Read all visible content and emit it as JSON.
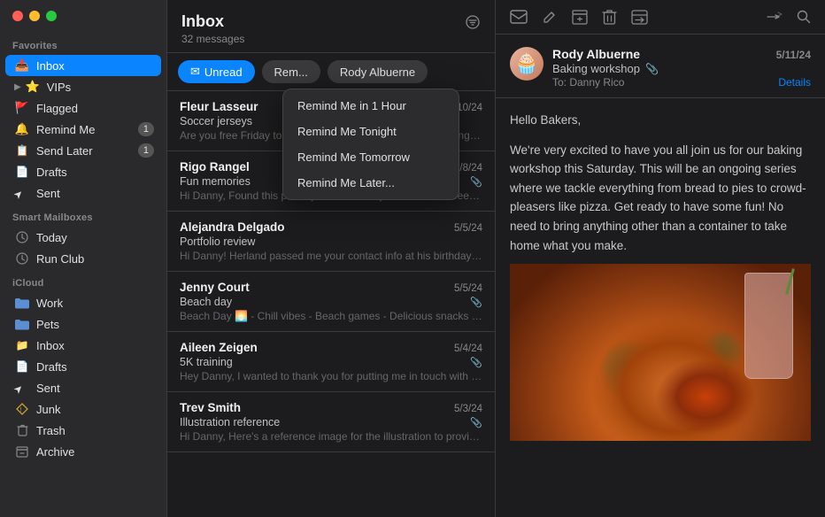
{
  "app": {
    "title": "Mail"
  },
  "sidebar": {
    "favorites_label": "Favorites",
    "smart_mailboxes_label": "Smart Mailboxes",
    "icloud_label": "iCloud",
    "items": {
      "inbox": {
        "label": "Inbox",
        "icon": "📥",
        "active": true
      },
      "vips": {
        "label": "VIPs",
        "icon": "⭐",
        "has_chevron": true
      },
      "flagged": {
        "label": "Flagged",
        "icon": "🚩"
      },
      "remind_me": {
        "label": "Remind Me",
        "icon": "🔔",
        "badge": "1"
      },
      "send_later": {
        "label": "Send Later",
        "icon": "📋",
        "badge": "1"
      },
      "drafts": {
        "label": "Drafts",
        "icon": "📄"
      },
      "sent": {
        "label": "Sent",
        "icon": "➤"
      },
      "today": {
        "label": "Today",
        "icon": "⚙"
      },
      "run_club": {
        "label": "Run Club",
        "icon": "⚙"
      },
      "work": {
        "label": "Work",
        "icon": "📁"
      },
      "pets": {
        "label": "Pets",
        "icon": "📁"
      },
      "icloud_inbox": {
        "label": "Inbox",
        "icon": "📁"
      },
      "icloud_drafts": {
        "label": "Drafts",
        "icon": "📄"
      },
      "icloud_sent": {
        "label": "Sent",
        "icon": "➤"
      },
      "junk": {
        "label": "Junk",
        "icon": "⚠"
      },
      "trash": {
        "label": "Trash",
        "icon": "🗑"
      },
      "archive": {
        "label": "Archive",
        "icon": "📦"
      }
    }
  },
  "message_list": {
    "title": "Inbox",
    "count": "32 messages",
    "filter_buttons": {
      "unread": "Unread",
      "reminders": "Rem...",
      "rody": "Rody Albuerne"
    },
    "messages": [
      {
        "sender": "Fleur Lasseur",
        "subject": "Soccer jerseys",
        "preview": "Are you free Friday to talk about the new jerseys? I'm working on a logo that I think the team will love.",
        "date": "5/10/24",
        "has_attachment": false
      },
      {
        "sender": "Rigo Rangel",
        "subject": "Fun memories",
        "preview": "Hi Danny, Found this photo you took! Can you believe it's been 10 years? Let's start planning our next adventure (or at least...",
        "date": "5/8/24",
        "has_attachment": true
      },
      {
        "sender": "Alejandra Delgado",
        "subject": "Portfolio review",
        "preview": "Hi Danny! Herland passed me your contact info at his birthday party last week and said it would be okay for me to reach out...",
        "date": "5/5/24",
        "has_attachment": false
      },
      {
        "sender": "Jenny Court",
        "subject": "Beach day",
        "preview": "Beach Day 🌅 - Chill vibes - Beach games - Delicious snacks - Excellent sunset viewing Who's coming? P.S. Can you gues...",
        "date": "5/5/24",
        "has_attachment": true
      },
      {
        "sender": "Aileen Zeigen",
        "subject": "5K training",
        "preview": "Hey Danny, I wanted to thank you for putting me in touch with the local running club. As you can see, I've been training wit...",
        "date": "5/4/24",
        "has_attachment": true
      },
      {
        "sender": "Trev Smith",
        "subject": "Illustration reference",
        "preview": "Hi Danny, Here's a reference image for the illustration to provide some direction. I want the piece to emulate this pose...",
        "date": "5/3/24",
        "has_attachment": true
      }
    ]
  },
  "remind_dropdown": {
    "items": [
      "Remind Me in 1 Hour",
      "Remind Me Tonight",
      "Remind Me Tomorrow",
      "Remind Me Later..."
    ]
  },
  "detail": {
    "sender": "Rody Albuerne",
    "subject": "Baking workshop",
    "to": "To:  Danny Rico",
    "date": "5/11/24",
    "details_label": "Details",
    "body_line1": "Hello Bakers,",
    "body_line2": "We're very excited to have you all join us for our baking workshop this Saturday. This will be an ongoing series where we tackle everything from bread to pies to crowd-pleasers like pizza. Get ready to have some fun! No need to bring anything other than a container to take home what you make.",
    "avatar_emoji": "🧁"
  },
  "toolbar": {
    "mail_icon": "✉",
    "compose_icon": "✏",
    "archive_icon": "📦",
    "trash_icon": "🗑",
    "move_icon": "📥",
    "more_icon": "»",
    "search_icon": "🔍"
  }
}
